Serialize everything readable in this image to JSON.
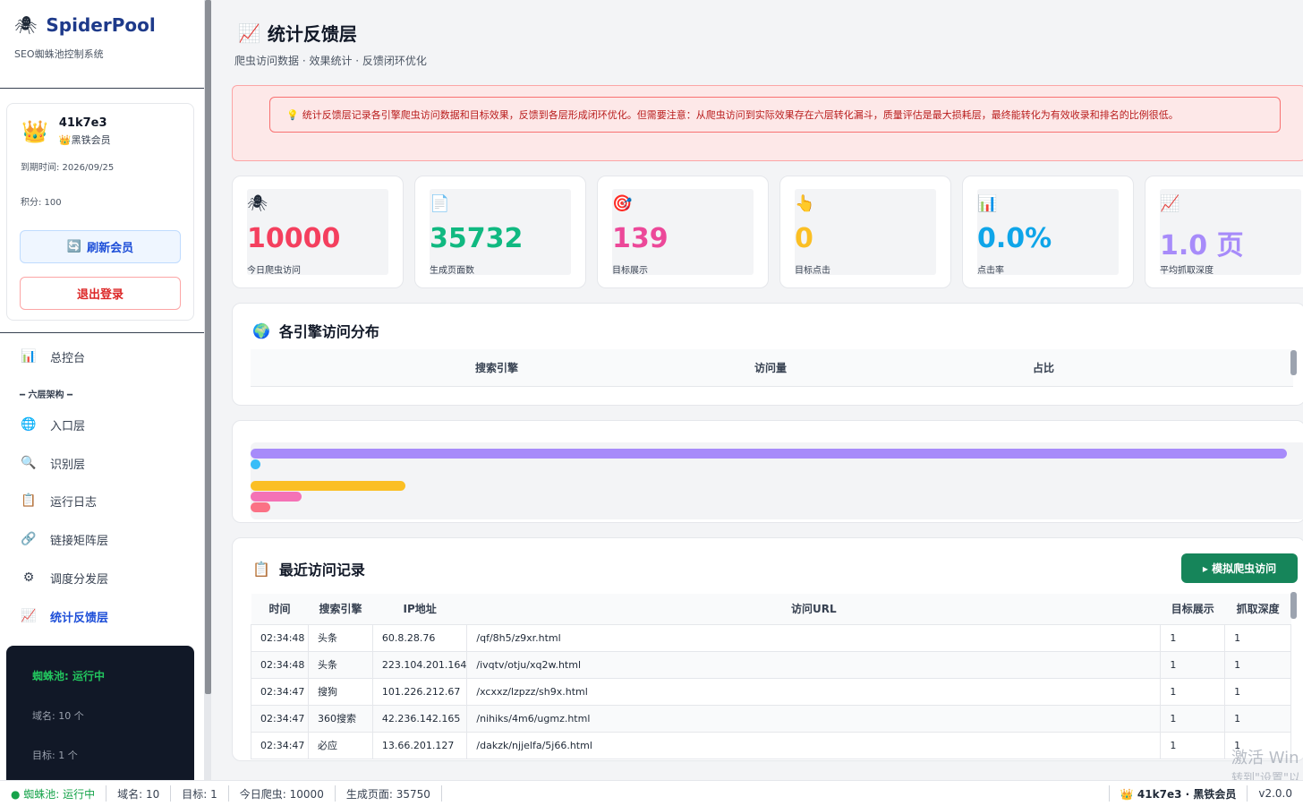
{
  "sidebar": {
    "brand_icon": "🕷",
    "brand_name": "SpiderPool",
    "brand_sub": "SEO蜘蛛池控制系统",
    "user": {
      "crown": "👑",
      "name": "41k7e3",
      "level": "👑黑铁会员",
      "expire": "到期时间: 2026/09/25",
      "points": "积分: 100",
      "refresh_icon": "🔄",
      "refresh_label": "刷新会员",
      "logout_label": "退出登录"
    },
    "nav": {
      "dashboard": {
        "icon": "📊",
        "label": "总控台"
      },
      "group_label": "━ 六层架构 ━",
      "entry": {
        "icon": "🌐",
        "label": "入口层"
      },
      "identify": {
        "icon": "🔍",
        "label": "识别层"
      },
      "logs": {
        "icon": "📋",
        "label": "运行日志"
      },
      "links": {
        "icon": "🔗",
        "label": "链接矩阵层"
      },
      "dispatch": {
        "icon": "⚙",
        "label": "调度分发层"
      },
      "stats": {
        "icon": "📈",
        "label": "统计反馈层"
      }
    },
    "status": {
      "running": "蜘蛛池: 运行中",
      "domains": "域名: 10 个",
      "targets": "目标: 1 个"
    }
  },
  "main": {
    "title_icon": "📈",
    "title": "统计反馈层",
    "subtitle": "爬虫访问数据 · 效果统计 · 反馈闭环优化",
    "alert_icon": "💡",
    "alert": "统计反馈层记录各引擎爬虫访问数据和目标效果，反馈到各层形成闭环优化。但需要注意：从爬虫访问到实际效果存在六层转化漏斗，质量评估是最大损耗层，最终能转化为有效收录和排名的比例很低。",
    "stats": [
      {
        "icon": "🕷",
        "value": "10000",
        "label": "今日爬虫访问",
        "color": "#f43f5e"
      },
      {
        "icon": "📄",
        "value": "35732",
        "label": "生成页面数",
        "color": "#10b981"
      },
      {
        "icon": "🎯",
        "value": "139",
        "label": "目标展示",
        "color": "#ec4899"
      },
      {
        "icon": "👆",
        "value": "0",
        "label": "目标点击",
        "color": "#f59e0b"
      },
      {
        "icon": "📊",
        "value": "0.0%",
        "label": "点击率",
        "color": "#0ea5e9"
      },
      {
        "icon": "📈",
        "value": "1.0 页",
        "label": "平均抓取深度",
        "color": "#a78bfa"
      }
    ],
    "engines": {
      "icon": "🌍",
      "title": "各引擎访问分布",
      "col_engine": "搜索引擎",
      "col_visits": "访问量",
      "col_ratio": "占比"
    },
    "bars": [
      {
        "fraction": 0.99,
        "color": "#a78bfa"
      },
      {
        "fraction": 0.009,
        "color": "#38bdf8"
      },
      {
        "fraction": 0.148,
        "color": "#fbbf24"
      },
      {
        "fraction": 0.049,
        "color": "#f472b6"
      },
      {
        "fraction": 0.019,
        "color": "#fb7185"
      }
    ],
    "recent": {
      "icon": "📋",
      "title": "最近访问记录",
      "simulate_label": "▸ 模拟爬虫访问",
      "headers": [
        "时间",
        "搜索引擎",
        "IP地址",
        "访问URL",
        "目标展示",
        "抓取深度"
      ],
      "rows": [
        [
          "02:34:48",
          "头条",
          "60.8.28.76",
          "/qf/8h5/z9xr.html",
          "1",
          "1"
        ],
        [
          "02:34:48",
          "头条",
          "223.104.201.164",
          "/ivqtv/otju/xq2w.html",
          "1",
          "1"
        ],
        [
          "02:34:47",
          "搜狗",
          "101.226.212.67",
          "/xcxxz/lzpzz/sh9x.html",
          "1",
          "1"
        ],
        [
          "02:34:47",
          "360搜索",
          "42.236.142.165",
          "/nihiks/4m6/ugmz.html",
          "1",
          "1"
        ],
        [
          "02:34:47",
          "必应",
          "13.66.201.127",
          "/dakzk/njjelfa/5j66.html",
          "1",
          "1"
        ]
      ]
    }
  },
  "footer": {
    "running": "● 蜘蛛池: 运行中",
    "domains": "域名: 10",
    "targets": "目标: 1",
    "today": "今日爬虫: 10000",
    "pages": "生成页面: 35750",
    "user": "👑 41k7e3 · 黑铁会员",
    "version": "v2.0.0"
  },
  "watermark": {
    "line1": "激活 Win",
    "line2": "转到\"设置\"以"
  }
}
